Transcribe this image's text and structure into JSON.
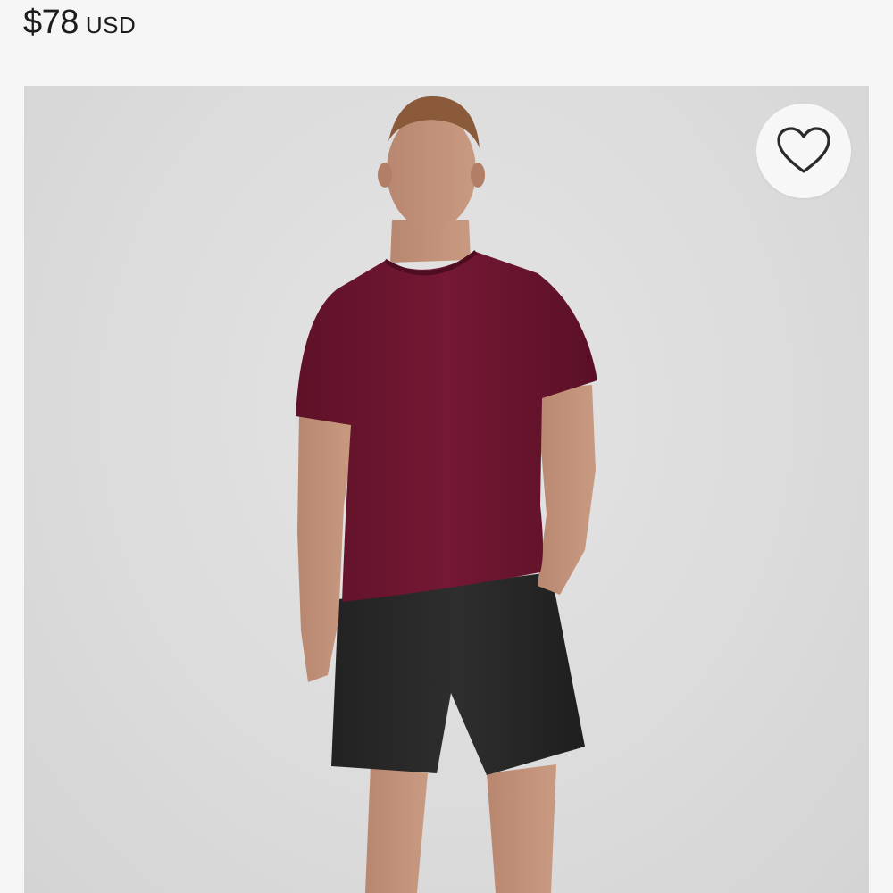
{
  "product": {
    "price_amount": "$78",
    "price_currency": "USD"
  },
  "image": {
    "subject": "model-wearing-shirt-and-shorts",
    "background_color": "#dcdcdc",
    "shirt_color": "#6e1530",
    "shorts_color": "#2a2a2a"
  },
  "wishlist": {
    "icon": "heart-outline-icon"
  }
}
